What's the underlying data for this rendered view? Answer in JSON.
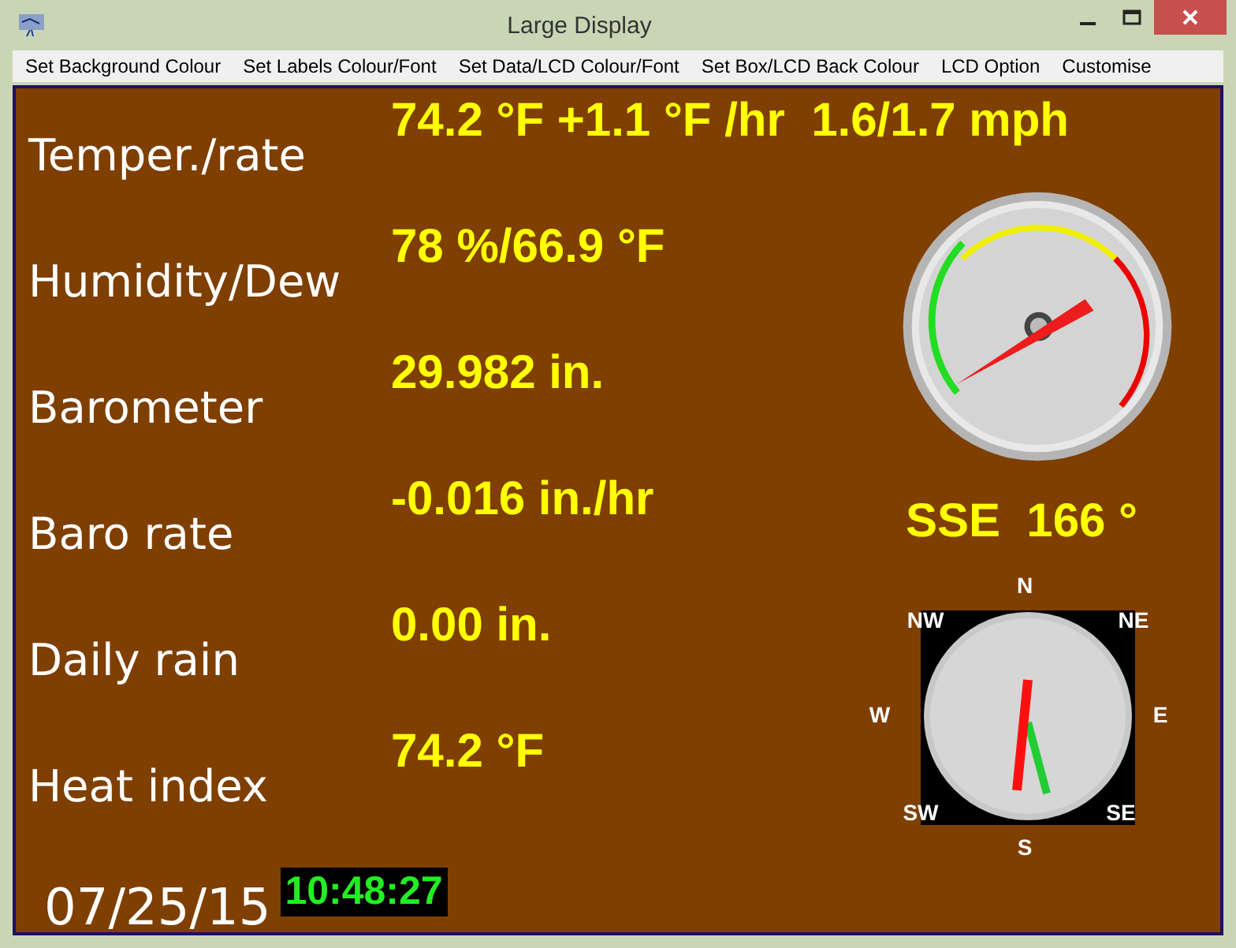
{
  "window": {
    "title": "Large Display"
  },
  "menu": [
    "Set Background Colour",
    "Set Labels Colour/Font",
    "Set Data/LCD Colour/Font",
    "Set Box/LCD Back Colour",
    "LCD Option",
    "Customise"
  ],
  "readings": [
    {
      "label": "Temper./rate",
      "value": "74.2 °F +1.1 °F /hr  1.6/1.7 mph"
    },
    {
      "label": "Humidity/Dew",
      "value": "78 %/66.9 °F"
    },
    {
      "label": "Barometer",
      "value": "29.982 in."
    },
    {
      "label": "Baro rate",
      "value": "-0.016 in./hr"
    },
    {
      "label": "Daily rain",
      "value": "0.00 in."
    },
    {
      "label": "Heat index",
      "value": "74.2 °F"
    }
  ],
  "wind_direction": "SSE  166 °",
  "compass_points": [
    "N",
    "NW",
    "NE",
    "W",
    "E",
    "SW",
    "SE",
    "S"
  ],
  "date": "07/25/15",
  "time": "10:48:27"
}
